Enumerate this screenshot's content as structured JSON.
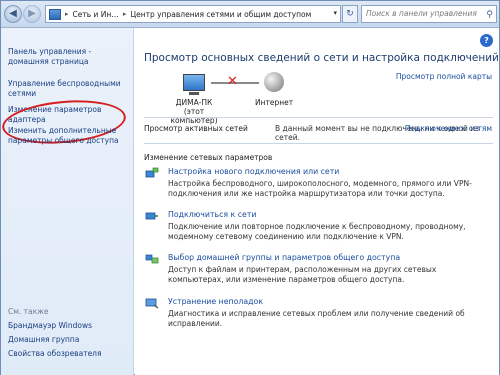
{
  "address": {
    "crumb1": "Сеть и Ин…",
    "crumb2": "Центр управления сетями и общим доступом",
    "search_placeholder": "Поиск в панели управления"
  },
  "sidebar": {
    "home": "Панель управления - домашняя страница",
    "wireless": "Управление беспроводными сетями",
    "adapter": "Изменение параметров адаптера",
    "sharing": "Изменить дополнительные параметры общего доступа",
    "see_also_heading": "См. также",
    "see_also": [
      "Брандмауэр Windows",
      "Домашняя группа",
      "Свойства обозревателя"
    ]
  },
  "main": {
    "title": "Просмотр основных сведений о сети и настройка подключений",
    "full_map": "Просмотр полной карты",
    "computer_name": "ДИМА-ПК",
    "computer_sub": "(этот компьютер)",
    "internet": "Интернет",
    "active_label": "Просмотр активных сетей",
    "active_text": "В данный момент вы не подключены ни к одной из сетей.",
    "connect": "Подключение к сетям",
    "change_heading": "Изменение сетевых параметров",
    "items": [
      {
        "link": "Настройка нового подключения или сети",
        "desc": "Настройка беспроводного, широкополосного, модемного, прямого или VPN-подключения или же настройка маршрутизатора или точки доступа."
      },
      {
        "link": "Подключиться к сети",
        "desc": "Подключение или повторное подключение к беспроводному, проводному, модемному сетевому соединению или подключение к VPN."
      },
      {
        "link": "Выбор домашней группы и параметров общего доступа",
        "desc": "Доступ к файлам и принтерам, расположенным на других сетевых компьютерах, или изменение параметров общего доступа."
      },
      {
        "link": "Устранение неполадок",
        "desc": "Диагностика и исправление сетевых проблем или получение сведений об исправлении."
      }
    ]
  }
}
